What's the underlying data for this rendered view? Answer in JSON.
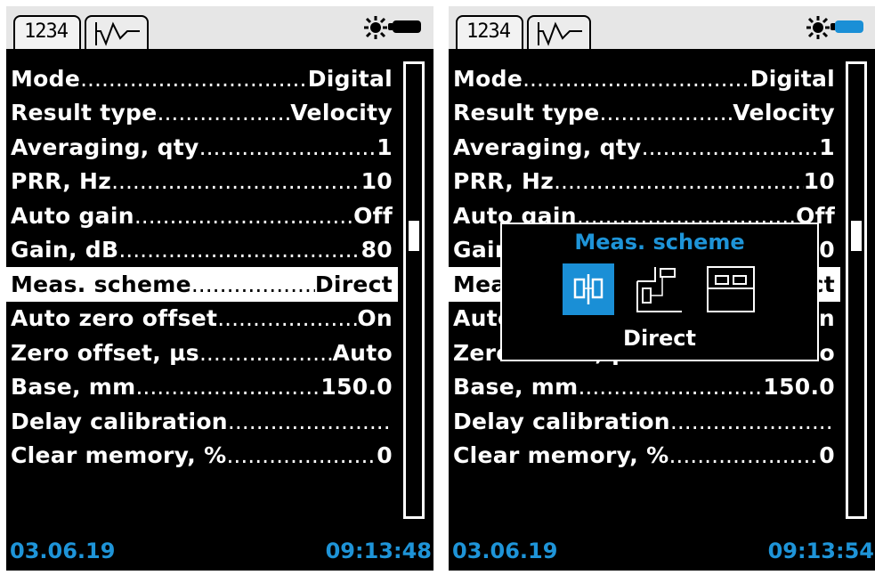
{
  "screens": [
    {
      "tab_digits_label": "1234",
      "menu": [
        {
          "label": "Mode",
          "value": "Digital"
        },
        {
          "label": "Result type",
          "value": "Velocity"
        },
        {
          "label": "Averaging, qty",
          "value": "1"
        },
        {
          "label": "PRR, Hz",
          "value": "10"
        },
        {
          "label": "Auto gain",
          "value": "Off"
        },
        {
          "label": "Gain, dB",
          "value": "80"
        },
        {
          "label": "Meas. scheme",
          "value": "Direct",
          "selected": true
        },
        {
          "label": "Auto zero offset",
          "value": "On"
        },
        {
          "label": "Zero offset, µs",
          "value": "Auto"
        },
        {
          "label": "Base, mm",
          "value": "150.0"
        },
        {
          "label": "Delay calibration",
          "value": ""
        },
        {
          "label": "Clear memory, %",
          "value": "0"
        }
      ],
      "date": "03.06.19",
      "time": "09:13:48",
      "battery_color": "#000000"
    },
    {
      "tab_digits_label": "1234",
      "menu": [
        {
          "label": "Mode",
          "value": "Digital"
        },
        {
          "label": "Result type",
          "value": "Velocity"
        },
        {
          "label": "Averaging, qty",
          "value": "1"
        },
        {
          "label": "PRR, Hz",
          "value": "10"
        },
        {
          "label": "Auto gain",
          "value": "Off"
        },
        {
          "label": "Gain, dB",
          "value": "80"
        },
        {
          "label": "Meas. scheme",
          "value": "Direct",
          "selected": true
        },
        {
          "label": "Auto zero offset",
          "value": "On"
        },
        {
          "label": "Zero offset, µs",
          "value": "Auto"
        },
        {
          "label": "Base, mm",
          "value": "150.0"
        },
        {
          "label": "Delay calibration",
          "value": ""
        },
        {
          "label": "Clear memory, %",
          "value": "0"
        }
      ],
      "date": "03.06.19",
      "time": "09:13:54",
      "battery_color": "#1a8fd6"
    }
  ],
  "dialog": {
    "title": "Meas. scheme",
    "options": [
      "direct-scheme-icon",
      "angled-scheme-icon",
      "surface-scheme-icon"
    ],
    "selected_option_index": 0,
    "current": "Direct"
  },
  "colors": {
    "accent": "#1e94d8",
    "background": "#000000",
    "text": "#ffffff"
  }
}
